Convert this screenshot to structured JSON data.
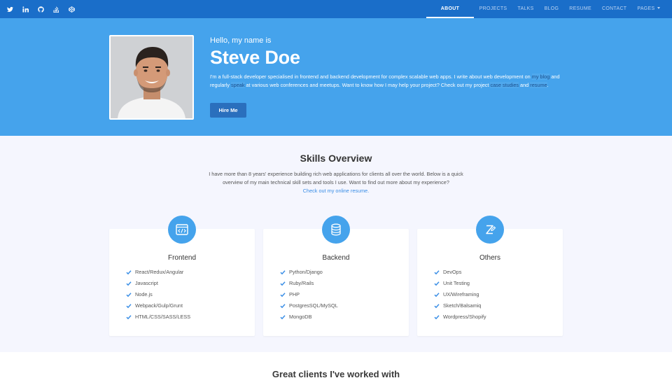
{
  "social": [
    {
      "name": "twitter-icon"
    },
    {
      "name": "linkedin-icon"
    },
    {
      "name": "github-icon"
    },
    {
      "name": "stackoverflow-icon"
    },
    {
      "name": "codepen-icon"
    }
  ],
  "nav": {
    "about": "ABOUT",
    "projects": "PROJECTS",
    "talks": "TALKS",
    "blog": "BLOG",
    "resume": "RESUME",
    "contact": "CONTACT",
    "pages": "PAGES"
  },
  "hero": {
    "greeting": "Hello, my name is",
    "name": "Steve Doe",
    "bio_part1": "I'm a full-stack developer specialised in frontend and backend development for complex scalable web apps. I write about web development on ",
    "bio_link_blog": "my blog",
    "bio_part2": " and regularly ",
    "bio_link_speak": "speak",
    "bio_part3": " at various web conferences and meetups. Want to know how I may help your project? Check out my project ",
    "bio_link_case": "case studies",
    "bio_part4": " and ",
    "bio_link_resume": "resume",
    "bio_part5": ".",
    "hire_label": "Hire Me"
  },
  "skills": {
    "title": "Skills Overview",
    "intro": "I have more than 8 years' experience building rich web applications for clients all over the world. Below is a quick overview of my main technical skill sets and tools I use. Want to find out more about my experience?",
    "intro_link": "Check out my online resume.",
    "cards": [
      {
        "title": "Frontend",
        "icon": "browser-code-icon",
        "items": [
          "React/Redux/Angular",
          "Javascript",
          "Node.js",
          "Webpack/Gulp/Grunt",
          "HTML/CSS/SASS/LESS"
        ]
      },
      {
        "title": "Backend",
        "icon": "database-icon",
        "items": [
          "Python/Django",
          "Ruby/Rails",
          "PHP",
          "PostgresSQL/MySQL",
          "MongoDB"
        ]
      },
      {
        "title": "Others",
        "icon": "pen-zigzag-icon",
        "items": [
          "DevOps",
          "Unit Testing",
          "UX/Wireframing",
          "Sketch/Balsamiq",
          "Wordpress/Shopify"
        ]
      }
    ]
  },
  "clients": {
    "title": "Great clients I've worked with"
  },
  "colors": {
    "topbar": "#1a6ec9",
    "hero": "#45a3ec",
    "accent": "#3a8ee6",
    "button": "#2a6fbd"
  }
}
